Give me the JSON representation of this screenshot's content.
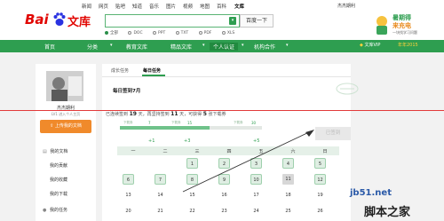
{
  "topnav": {
    "items": [
      "新闻",
      "网页",
      "贴吧",
      "知道",
      "音乐",
      "图片",
      "视频",
      "地图",
      "百科",
      "文库"
    ],
    "active": "文库",
    "user": "杰杰期利"
  },
  "header": {
    "logo_text": "Bai",
    "logo_suffix": "文库",
    "search_button": "百度一下",
    "search_value": "",
    "filters": [
      "全部",
      "DOC",
      "PPT",
      "TXT",
      "PDF",
      "XLS"
    ],
    "selected_filter": "全部",
    "promo_line1": "暑期得",
    "promo_line2": "来充电",
    "promo_line3": "一块找学习问题"
  },
  "mainnav": {
    "items": [
      "首页",
      "分类",
      "教育文库",
      "精品文库",
      "个人认证",
      "机构合作"
    ],
    "active": "个人认证",
    "vip": "文库VIP",
    "year": "年年2015"
  },
  "sidebar": {
    "username": "杰杰期利",
    "level": "LV1  进入个人主页",
    "upload": "上传我的文档",
    "items": [
      "我的文档",
      "我的贡献",
      "我的收藏",
      "我的下载",
      "我的任务"
    ]
  },
  "panel": {
    "tabs": [
      "成长任务",
      "每日任务"
    ],
    "active_tab": "每日任务",
    "title": "每日签到7月",
    "progress_prefix": "已连续签到",
    "streak_days": "19",
    "progress_mid": "天，再坚持签到",
    "remaining_days": "11",
    "progress_mid2": "天，可获得",
    "reward_count": "5",
    "progress_suffix": "张下载券",
    "signin_button": "已签到",
    "milestones": [
      {
        "label": "下载券",
        "day": "7",
        "bonus": "+1"
      },
      {
        "label": "下载券",
        "day": "15",
        "bonus": "+3"
      },
      {
        "label": "下载券",
        "day": "30",
        "bonus": "+5"
      }
    ],
    "progress_fraction": 0.63,
    "weekdays": [
      "一",
      "二",
      "三",
      "四",
      "五",
      "六",
      "日"
    ],
    "weeks": [
      [
        "",
        "",
        "1",
        "2",
        "3",
        "4",
        "5"
      ],
      [
        "6",
        "7",
        "8",
        "9",
        "10",
        "11",
        "12"
      ],
      [
        "13",
        "14",
        "15",
        "16",
        "17",
        "18",
        "19"
      ],
      [
        "20",
        "21",
        "22",
        "23",
        "24",
        "25",
        "26"
      ]
    ],
    "signed": [
      "1",
      "2",
      "3",
      "4",
      "5",
      "6",
      "7",
      "8",
      "9",
      "10",
      "11",
      "12"
    ],
    "today": "11"
  },
  "watermark": {
    "line1": "jb51.net",
    "line2": "脚本之家"
  },
  "colors": {
    "brand_green": "#2e9e50",
    "upload_orange": "#f08a2b",
    "annotation_red": "#e23a3a"
  }
}
